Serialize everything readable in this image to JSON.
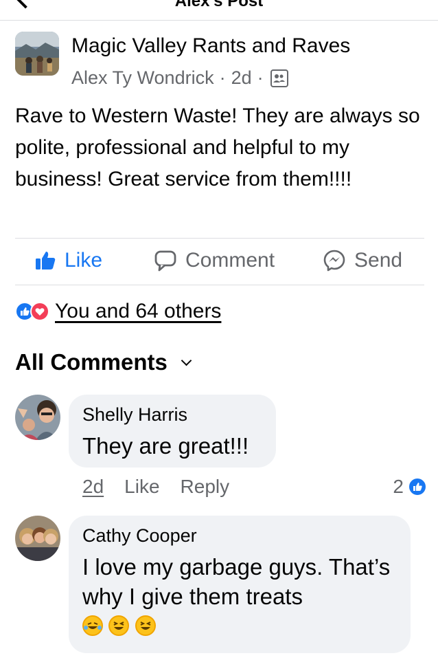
{
  "topbar": {
    "title": "Alex's Post"
  },
  "post": {
    "group_name": "Magic Valley Rants and Raves",
    "author": "Alex Ty Wondrick",
    "time": "2d",
    "separator": "·",
    "body": "Rave to Western Waste! They are always so polite, professional and helpful to my business! Great service from them!!!!"
  },
  "actions": {
    "like": "Like",
    "comment": "Comment",
    "send": "Send"
  },
  "reactions": {
    "summary": "You and 64 others"
  },
  "comments_header": {
    "label": "All Comments"
  },
  "comments": [
    {
      "name": "Shelly Harris",
      "text": "They are great!!!",
      "time": "2d",
      "like": "Like",
      "reply": "Reply",
      "reaction_count": "2"
    },
    {
      "name": "Cathy Cooper",
      "text": "I love my garbage guys. That’s why I give them treats",
      "emojis": [
        "laughing-tears-emoji",
        "grinning-squint-emoji",
        "grinning-squint-emoji"
      ]
    }
  ],
  "colors": {
    "accent": "#1877f2",
    "secondary_text": "#65676b",
    "bubble": "#f0f2f5",
    "love": "#f33e58"
  }
}
